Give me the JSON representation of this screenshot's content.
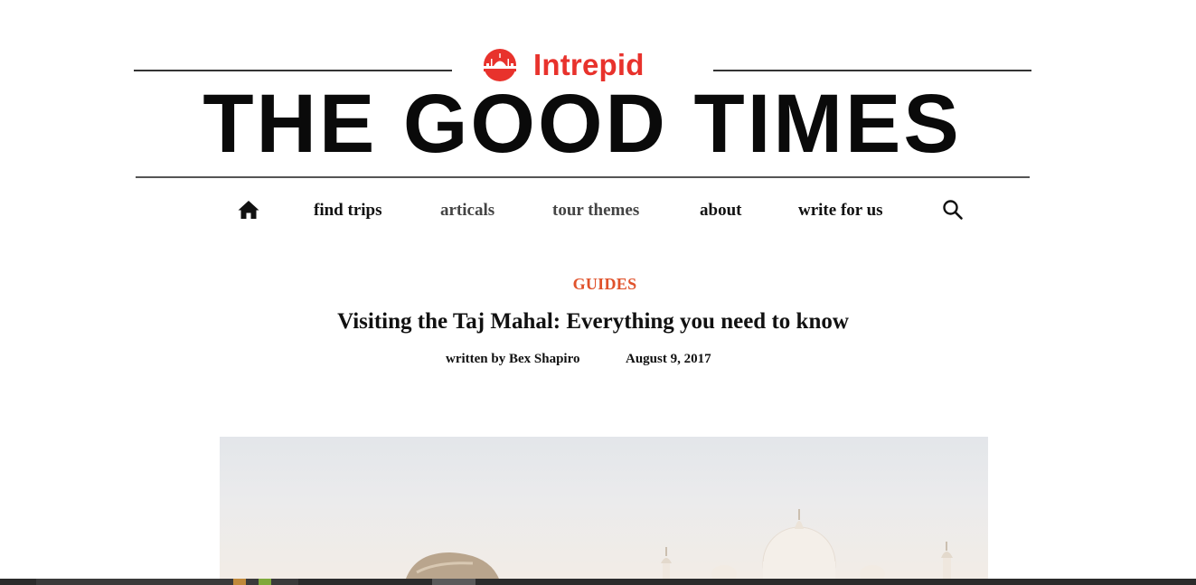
{
  "brand": {
    "name": "Intrepid",
    "color": "#e8322c",
    "logo_icon": "intrepid-logo-icon"
  },
  "site": {
    "title": "THE GOOD TIMES"
  },
  "nav": {
    "home_icon": "home-icon",
    "items": [
      {
        "label": "find trips"
      },
      {
        "label": "articals"
      },
      {
        "label": "tour themes"
      },
      {
        "label": "about"
      },
      {
        "label": "write for us"
      }
    ],
    "search_icon": "search-icon"
  },
  "article": {
    "category": "GUIDES",
    "category_color": "#e0522b",
    "title": "Visiting the Taj Mahal: Everything you need to know",
    "byline": "written by Bex Shapiro",
    "date": "August 9, 2017"
  },
  "hero": {
    "subject": "Taj Mahal photo"
  }
}
